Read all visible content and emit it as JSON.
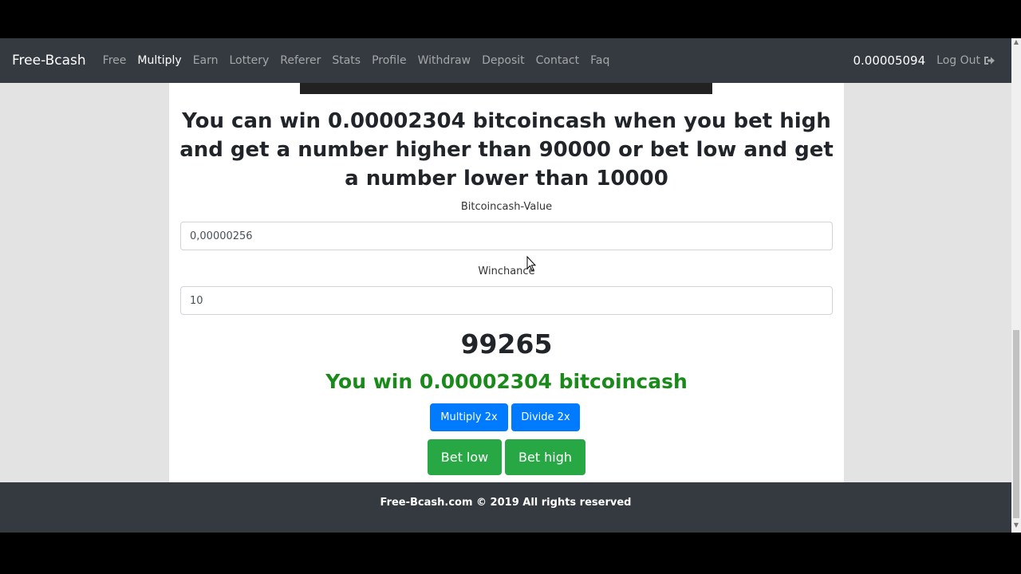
{
  "navbar": {
    "brand": "Free-Bcash",
    "links": [
      "Free",
      "Multiply",
      "Earn",
      "Lottery",
      "Referer",
      "Stats",
      "Profile",
      "Withdraw",
      "Deposit",
      "Contact",
      "Faq"
    ],
    "active": "Multiply",
    "balance": "0.00005094",
    "logout_label": "Log Out"
  },
  "main": {
    "headline": "You can win 0.00002304 bitcoincash when you bet high and get a number higher than 90000 or bet low and get a number lower than 10000",
    "bet_value_label": "Bitcoincash-Value",
    "bet_value": "0,00000256",
    "winchance_label": "Winchance",
    "winchance_value": "10",
    "roll_number": "99265",
    "result_text": "You win 0.00002304 bitcoincash",
    "multiply_label": "Multiply 2x",
    "divide_label": "Divide 2x",
    "bet_low_label": "Bet low",
    "bet_high_label": "Bet high"
  },
  "footer": {
    "text": "Free-Bcash.com © 2019 All rights reserved"
  },
  "colors": {
    "navbar": "#343a40",
    "primary": "#007bff",
    "success": "#28a745",
    "win_text": "#1a8a1a"
  }
}
